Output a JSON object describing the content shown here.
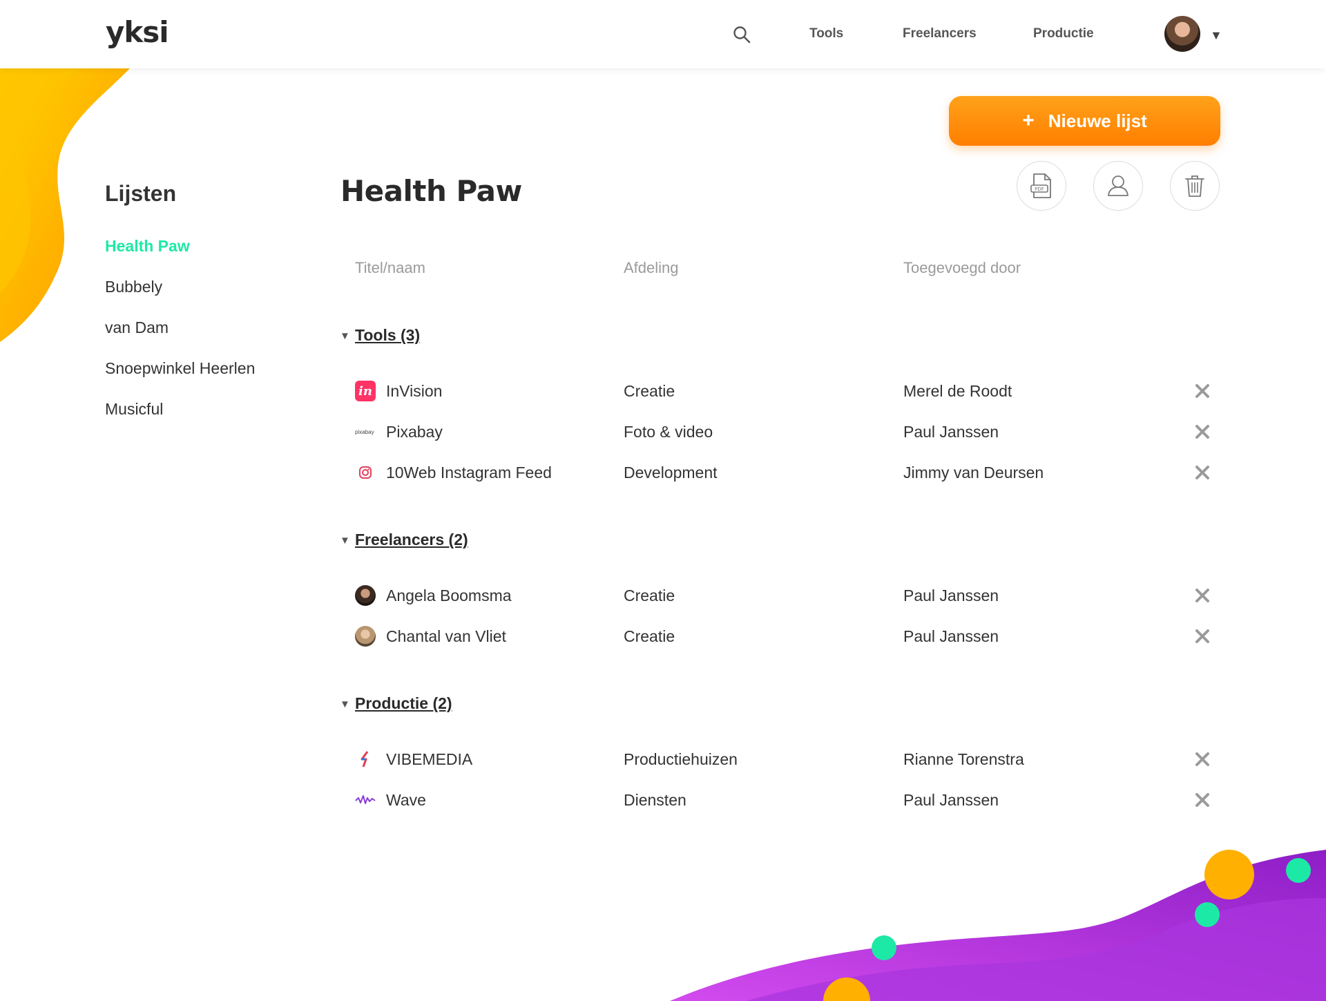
{
  "header": {
    "logo": "yksi",
    "nav": [
      "Tools",
      "Freelancers",
      "Productie"
    ]
  },
  "sidebar": {
    "title": "Lijsten",
    "items": [
      {
        "label": "Health Paw",
        "active": true
      },
      {
        "label": "Bubbely",
        "active": false
      },
      {
        "label": "van Dam",
        "active": false
      },
      {
        "label": "Snoepwinkel Heerlen",
        "active": false
      },
      {
        "label": "Musicful",
        "active": false
      }
    ]
  },
  "main": {
    "new_list_label": "Nieuwe lijst",
    "title": "Health Paw",
    "columns": [
      "Titel/naam",
      "Afdeling",
      "Toegevoegd door"
    ],
    "groups": [
      {
        "label": "Tools (3)",
        "rows": [
          {
            "name": "InVision",
            "dept": "Creatie",
            "added_by": "Merel de Roodt",
            "icon": "invision-icon",
            "icon_text": "in"
          },
          {
            "name": "Pixabay",
            "dept": "Foto & video",
            "added_by": "Paul Janssen",
            "icon": "pixabay-icon",
            "icon_text": "pixabay"
          },
          {
            "name": "10Web Instagram Feed",
            "dept": "Development",
            "added_by": "Jimmy van Deursen",
            "icon": "instagram-icon"
          }
        ]
      },
      {
        "label": "Freelancers (2)",
        "rows": [
          {
            "name": "Angela Boomsma",
            "dept": "Creatie",
            "added_by": "Paul Janssen",
            "icon": "avatar-angela"
          },
          {
            "name": "Chantal van Vliet",
            "dept": "Creatie",
            "added_by": "Paul Janssen",
            "icon": "avatar-chantal"
          }
        ]
      },
      {
        "label": "Productie (2)",
        "rows": [
          {
            "name": "VIBEMEDIA",
            "dept": "Productiehuizen",
            "added_by": "Rianne Torenstra",
            "icon": "vibemedia-icon"
          },
          {
            "name": "Wave",
            "dept": "Diensten",
            "added_by": "Paul Janssen",
            "icon": "wave-icon"
          }
        ]
      }
    ]
  },
  "colors": {
    "accent": "#1de9a6",
    "button": "#ff8c00",
    "orange_blob": "#ffb300",
    "purple_wave": "#a526d9"
  }
}
